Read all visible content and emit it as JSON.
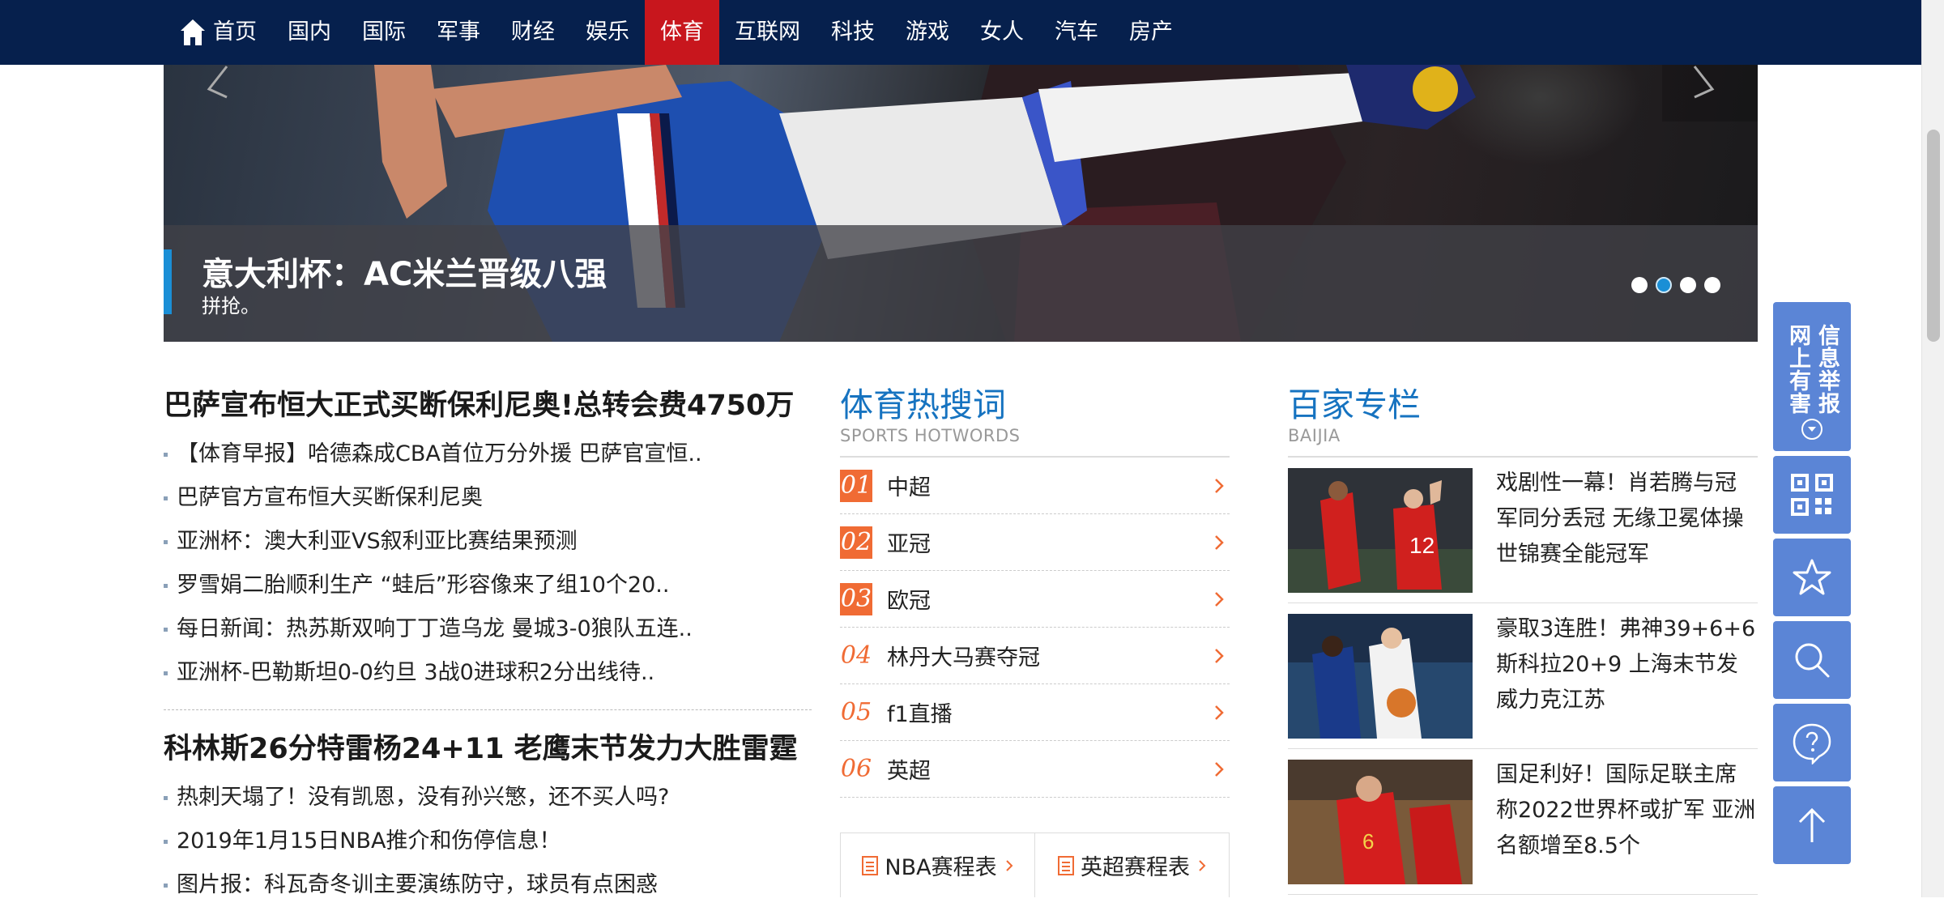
{
  "nav": {
    "items": [
      "首页",
      "国内",
      "国际",
      "军事",
      "财经",
      "娱乐",
      "体育",
      "互联网",
      "科技",
      "游戏",
      "女人",
      "汽车",
      "房产"
    ],
    "active": "体育"
  },
  "banner": {
    "title": "意大利杯：AC米兰晋级八强",
    "subtitle": "拼抢。",
    "slides": 4,
    "active_slide": 2
  },
  "news": {
    "groups": [
      {
        "headline": "巴萨宣布恒大正式买断保利尼奥!总转会费4750万",
        "items": [
          "【体育早报】哈德森成CBA首位万分外援 巴萨官宣恒..",
          "巴萨官方宣布恒大买断保利尼奥",
          "亚洲杯：澳大利亚VS叙利亚比赛结果预测",
          "罗雪娟二胎顺利生产 “蛙后”形容像来了组10个20..",
          "每日新闻：热苏斯双响丁丁造乌龙 曼城3-0狼队五连..",
          "亚洲杯-巴勒斯坦0-0约旦 3战0进球积2分出线待.."
        ]
      },
      {
        "headline": "科林斯26分特雷杨24+11 老鹰末节发力大胜雷霆",
        "items": [
          "热刺天塌了！没有凯恩，没有孙兴慜，还不买人吗?",
          "2019年1月15日NBA推介和伤停信息！",
          "图片报：科瓦奇冬训主要演练防守，球员有点困惑"
        ]
      }
    ]
  },
  "hotwords": {
    "title": "体育热搜词",
    "subtitle": "SPORTS HOTWORDS",
    "items": [
      {
        "num": "01",
        "label": "中超"
      },
      {
        "num": "02",
        "label": "亚冠"
      },
      {
        "num": "03",
        "label": "欧冠"
      },
      {
        "num": "04",
        "label": "林丹大马赛夺冠"
      },
      {
        "num": "05",
        "label": "f1直播"
      },
      {
        "num": "06",
        "label": "英超"
      }
    ],
    "schedules": [
      "NBA赛程表",
      "英超赛程表"
    ]
  },
  "baijia": {
    "title": "百家专栏",
    "subtitle": "BAIJIA",
    "items": [
      {
        "text": "戏剧性一幕！肖若腾与冠军同分丢冠 无缘卫冕体操世锦赛全能冠军"
      },
      {
        "text": "豪取3连胜！弗神39+6+6斯科拉20+9 上海末节发威力克江苏"
      },
      {
        "text": "国足利好！国际足联主席称2022世界杯或扩军 亚洲名额增至8.5个"
      }
    ]
  },
  "tools": {
    "report_col1": "信息举报",
    "report_col2": "网上有害"
  },
  "colors": {
    "nav_bg": "#06204d",
    "nav_active": "#c8161d",
    "accent_blue": "#1673c0",
    "hot_orange": "#f06b34",
    "tool_blue": "#5b85d6"
  }
}
